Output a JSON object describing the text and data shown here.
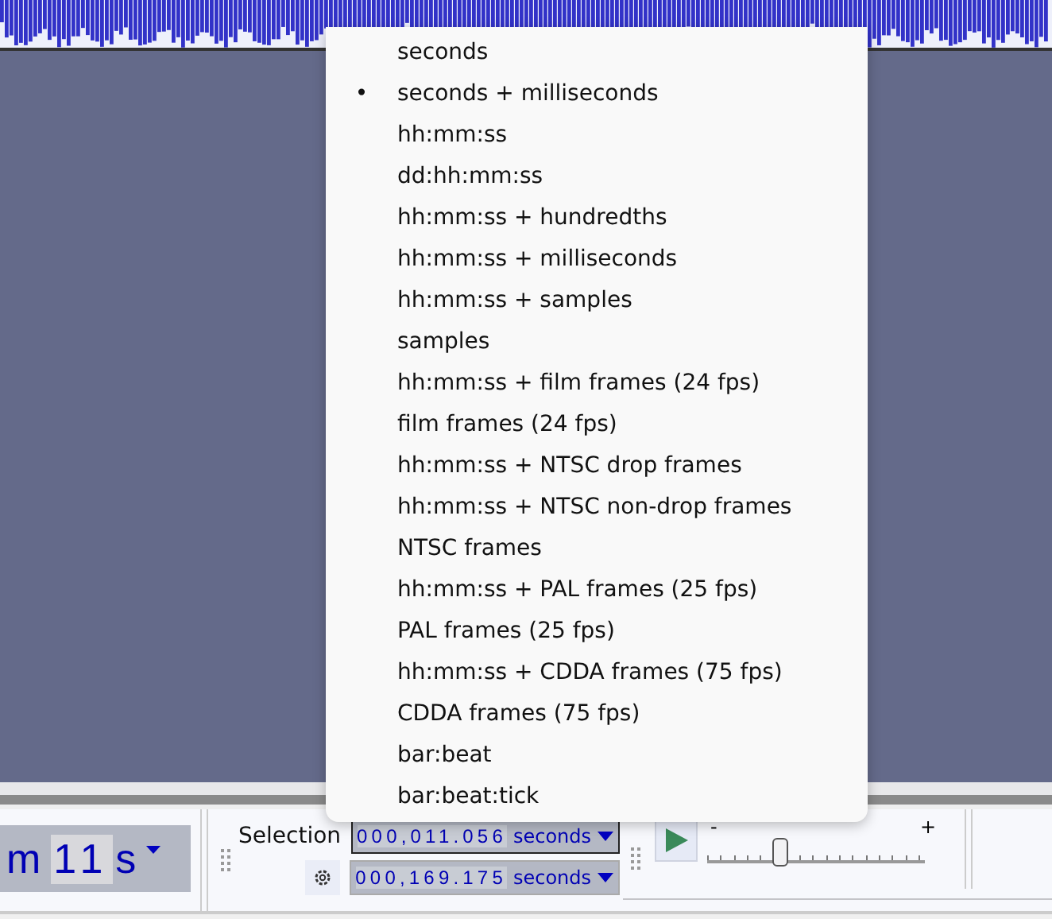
{
  "format_menu": {
    "items": [
      {
        "label": "seconds",
        "selected": false
      },
      {
        "label": "seconds + milliseconds",
        "selected": true
      },
      {
        "label": "hh:mm:ss",
        "selected": false
      },
      {
        "label": "dd:hh:mm:ss",
        "selected": false
      },
      {
        "label": "hh:mm:ss + hundredths",
        "selected": false
      },
      {
        "label": "hh:mm:ss + milliseconds",
        "selected": false
      },
      {
        "label": "hh:mm:ss + samples",
        "selected": false
      },
      {
        "label": "samples",
        "selected": false
      },
      {
        "label": "hh:mm:ss + film frames (24 fps)",
        "selected": false
      },
      {
        "label": "film frames (24 fps)",
        "selected": false
      },
      {
        "label": "hh:mm:ss + NTSC drop frames",
        "selected": false
      },
      {
        "label": "hh:mm:ss + NTSC non-drop frames",
        "selected": false
      },
      {
        "label": "NTSC frames",
        "selected": false
      },
      {
        "label": "hh:mm:ss + PAL frames (25 fps)",
        "selected": false
      },
      {
        "label": "PAL frames (25 fps)",
        "selected": false
      },
      {
        "label": "hh:mm:ss + CDDA frames (75 fps)",
        "selected": false
      },
      {
        "label": "CDDA frames (75 fps)",
        "selected": false
      },
      {
        "label": "bar:beat",
        "selected": false
      },
      {
        "label": "bar:beat:tick",
        "selected": false
      }
    ],
    "bullet": "•"
  },
  "time_display": {
    "minutes_unit": "m",
    "seconds": "11",
    "seconds_unit": "s"
  },
  "selection": {
    "label": "Selection",
    "start": {
      "value": "000,011.056",
      "unit": "seconds"
    },
    "end": {
      "value": "000,169.175",
      "unit": "seconds"
    }
  },
  "play_speed": {
    "minus": "-",
    "plus": "+",
    "level": 0.34
  }
}
